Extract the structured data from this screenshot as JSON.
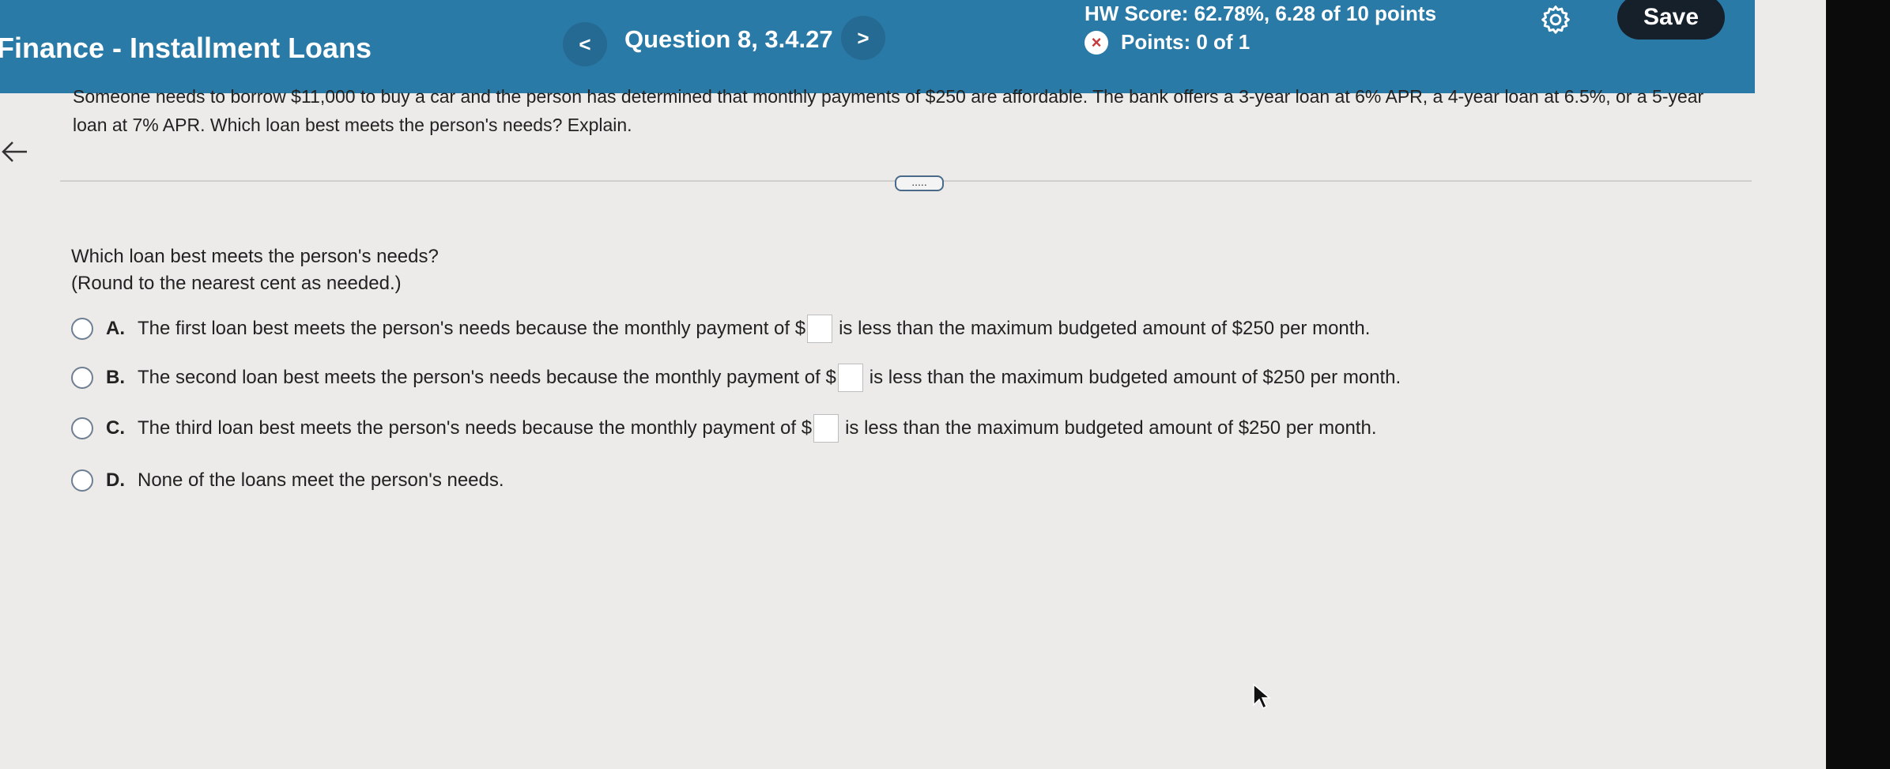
{
  "header": {
    "app_title": "Finance - Installment Loans",
    "prev_symbol": "<",
    "next_symbol": ">",
    "question_label": "Question 8, 3.4.27",
    "hw_score": "HW Score: 62.78%, 6.28 of 10 points",
    "points": "Points: 0 of 1",
    "points_icon": "x-circle-icon",
    "save_label": "Save",
    "settings_icon": "gear-icon",
    "colors": {
      "header_bg": "#2a7aa7",
      "save_bg": "#15202b"
    }
  },
  "problem": {
    "text": "Someone needs to borrow $11,000 to buy a car and the person has determined that monthly payments of $250 are affordable. The bank offers a 3-year loan at 6% APR, a 4-year loan at 6.5%, or a 5-year loan at 7% APR. Which loan best meets the person's needs? Explain.",
    "more_label": "....."
  },
  "question": {
    "prompt_line1": "Which loan best meets the person's needs?",
    "prompt_line2": "(Round to the nearest cent as needed.)",
    "options": [
      {
        "letter": "A.",
        "before": "The first loan best meets the person's needs because the monthly payment of $",
        "after": "is less than the maximum budgeted amount of $250 per month."
      },
      {
        "letter": "B.",
        "before": "The second loan best meets the person's needs because the monthly payment of $",
        "after": "is less than the maximum budgeted amount of $250 per month."
      },
      {
        "letter": "C.",
        "before": "The third loan best meets the person's needs because the monthly payment of $",
        "after": "is less than the maximum budgeted amount of $250 per month."
      },
      {
        "letter": "D.",
        "text": "None of the loans meet the person's needs."
      }
    ]
  }
}
